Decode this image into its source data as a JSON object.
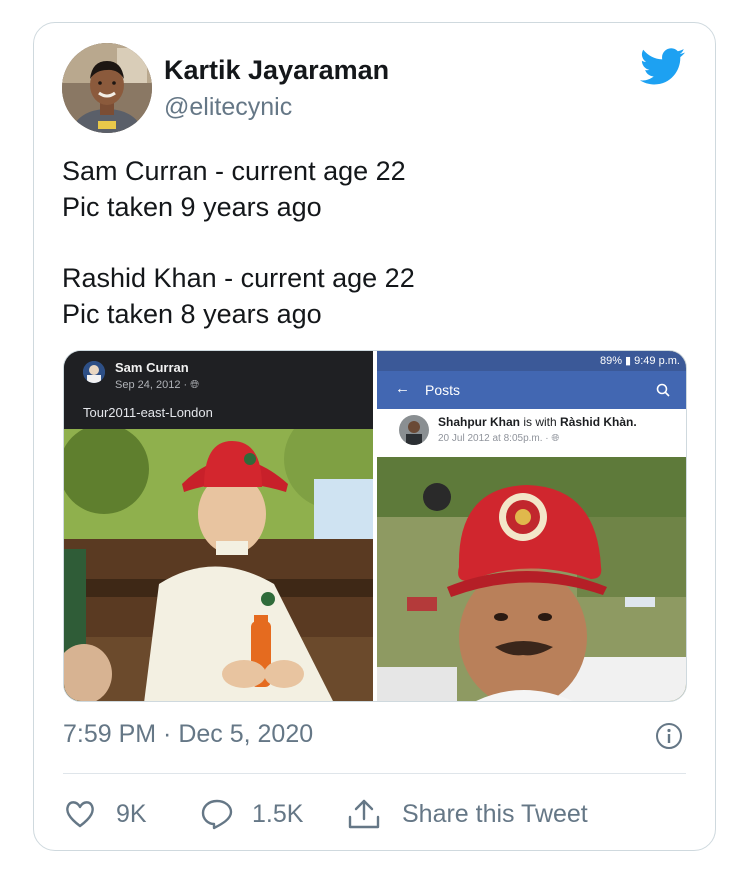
{
  "tweet": {
    "author_name": "Kartik Jayaraman",
    "author_handle": "@elitecynic",
    "lines": [
      "Sam Curran - current age 22",
      "Pic taken 9 years ago",
      "Rashid Khan - current age 22",
      "Pic taken 8 years ago"
    ],
    "timestamp": "7:59 PM · Dec 5, 2020",
    "likes": "9K",
    "replies": "1.5K",
    "share_label": "Share this Tweet"
  },
  "media": {
    "left": {
      "poster": "Sam Curran",
      "date": "Sep 24, 2012 ·",
      "caption": "Tour2011-east-London"
    },
    "right": {
      "status_bar": "89% ▮ 9:49 p.m.",
      "header_title": "Posts",
      "poster": "Shahpur Khan",
      "with_text": " is with ",
      "tagged": "Ràshid Khàn.",
      "date": "20 Jul 2012 at 8:05p.m. ·"
    }
  },
  "colors": {
    "twitter_blue": "#1da1f2",
    "facebook_blue": "#3b5998",
    "text_primary": "#14171a",
    "text_secondary": "#657786",
    "border": "#cfd9de"
  },
  "icons": [
    "twitter-bird-icon",
    "info-icon",
    "heart-icon",
    "reply-bubble-icon",
    "share-icon",
    "back-arrow-icon",
    "search-icon",
    "globe-icon"
  ]
}
